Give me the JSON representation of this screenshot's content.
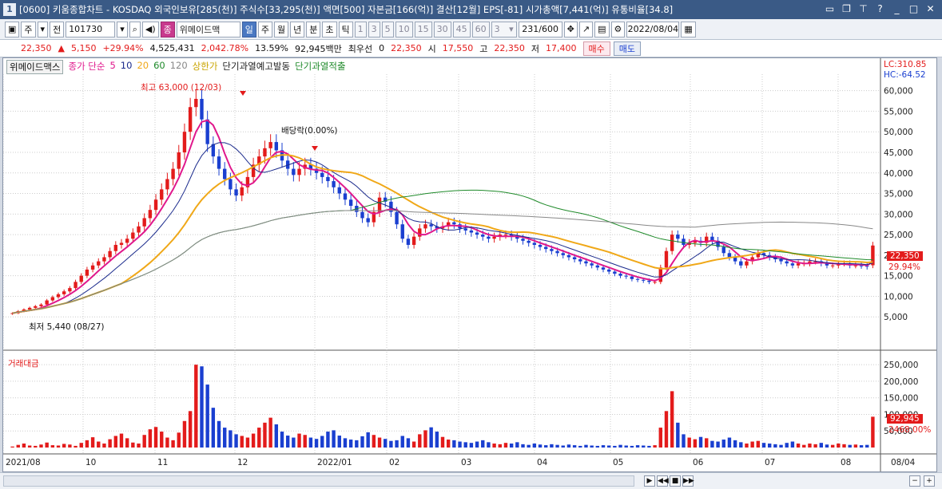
{
  "window": {
    "title": "[0600] 키움종합차트 - KOSDAQ 외국인보유[285(천)] 주식수[33,295(천)] 액면[500] 자본금[166(억)] 결산[12월] EPS[-81] 시가총액[7,441(억)] 유통비율[34.8]",
    "app_number": "1"
  },
  "toolbar": {
    "period_buttons": [
      "주",
      "전"
    ],
    "code": "101730",
    "stock_badge": "종",
    "stock_name": "위메이드맥",
    "intervals": [
      "일",
      "주",
      "월",
      "년",
      "분",
      "초",
      "틱"
    ],
    "minutes": [
      "1",
      "3",
      "5",
      "10",
      "15",
      "30",
      "45",
      "60"
    ],
    "count_select": "3",
    "count": "231",
    "count_total": "/600",
    "date": "2022/08/04"
  },
  "quote": {
    "price": "22,350",
    "change": "5,150",
    "change_pct": "+29.94%",
    "volume": "4,525,431",
    "vol_pct": "2,042.78%",
    "turnover": "13.59%",
    "amount": "92,945백만",
    "priority_label": "최우선",
    "priority_value": "0",
    "priority_price": "22,350",
    "open_label": "시",
    "open": "17,550",
    "high_label": "고",
    "high": "22,350",
    "low_label": "저",
    "low": "17,400",
    "buy": "매수",
    "sell": "매도"
  },
  "legend": {
    "name": "위메이드맥스",
    "ma_label": "종가 단순",
    "mas": [
      "5",
      "10",
      "20",
      "60",
      "120"
    ],
    "limit": "상한가",
    "sig1": "단기과열예고발동",
    "sig2": "단기과열적출"
  },
  "annotations": {
    "high": "최고 63,000 (12/03)",
    "dividend": "배당락(0.00%)",
    "low": "최저 5,440 (08/27)",
    "lc": "LC:310.85",
    "hc": "HC:-64.52",
    "cur_price": "22,350",
    "cur_pct": "29.94%",
    "vol_label": "거래대금",
    "cur_amount": "92,945",
    "cur_amount_pct": "2468.00%"
  },
  "price_axis": [
    "60,000",
    "55,000",
    "50,000",
    "45,000",
    "40,000",
    "35,000",
    "30,000",
    "25,000",
    "20,000",
    "15,000",
    "10,000",
    "5,000"
  ],
  "volume_axis": [
    "250,000",
    "200,000",
    "150,000",
    "100,000",
    "50,000"
  ],
  "date_axis": [
    "2021/08",
    "10",
    "11",
    "12",
    "2022/01",
    "02",
    "03",
    "04",
    "05",
    "06",
    "07",
    "08",
    "08/04"
  ],
  "colors": {
    "up": "#e31b1b",
    "down": "#1a3fd0",
    "ma5": "#e0188c",
    "ma10": "#1a2a8c",
    "ma20": "#f0a818",
    "ma60": "#1f8a2a",
    "ma120": "#888888"
  },
  "chart_data": {
    "type": "candlestick",
    "title": "위메이드맥스",
    "x_range": [
      "2021/08",
      "2022/08/04"
    ],
    "ylim": [
      0,
      63000
    ],
    "closes": [
      5900,
      6400,
      6800,
      7200,
      7600,
      8000,
      9000,
      9800,
      10500,
      11200,
      12000,
      13500,
      15000,
      16500,
      17500,
      18500,
      19500,
      21000,
      22500,
      23000,
      24000,
      25500,
      27000,
      29000,
      31000,
      33500,
      36000,
      38500,
      41000,
      45000,
      50000,
      56000,
      58000,
      53000,
      47000,
      44000,
      41000,
      38500,
      36000,
      34500,
      36500,
      39000,
      42000,
      44000,
      46000,
      47500,
      45500,
      43000,
      41000,
      39500,
      41000,
      42000,
      41000,
      40000,
      39000,
      38000,
      36500,
      35000,
      33500,
      32000,
      30500,
      29000,
      28000,
      30500,
      34000,
      33000,
      30500,
      27500,
      24000,
      22500,
      24500,
      26500,
      27500,
      27000,
      26500,
      27000,
      28000,
      27500,
      26500,
      26000,
      25500,
      25000,
      24500,
      24000,
      24500,
      25000,
      25000,
      24500,
      24000,
      23500,
      23000,
      22500,
      22000,
      21500,
      21000,
      20500,
      20000,
      19500,
      19000,
      18500,
      18000,
      17500,
      17000,
      16500,
      16000,
      15500,
      15000,
      14800,
      14200,
      14000,
      13800,
      13500,
      13500,
      17000,
      21000,
      25000,
      24000,
      22500,
      23000,
      23500,
      23000,
      24500,
      23500,
      22000,
      20500,
      19500,
      18500,
      17500,
      18500,
      19500,
      20500,
      20000,
      19500,
      19000,
      18500,
      18000,
      17500,
      18000,
      18000,
      18500,
      18500,
      18000,
      17500,
      17500,
      18000,
      18000,
      17500,
      17500,
      17400,
      17200,
      22350
    ],
    "volumes": [
      3000,
      8000,
      12000,
      6000,
      5000,
      9000,
      15000,
      7000,
      6000,
      11000,
      9000,
      5000,
      14000,
      22000,
      31000,
      18000,
      12000,
      25000,
      35000,
      42000,
      28000,
      15000,
      12000,
      38000,
      55000,
      62000,
      48000,
      30000,
      22000,
      45000,
      80000,
      110000,
      250000,
      245000,
      190000,
      120000,
      80000,
      60000,
      52000,
      40000,
      35000,
      30000,
      42000,
      60000,
      75000,
      90000,
      70000,
      48000,
      36000,
      30000,
      42000,
      38000,
      30000,
      26000,
      35000,
      48000,
      52000,
      36000,
      28000,
      24000,
      22000,
      34000,
      46000,
      38000,
      30000,
      26000,
      20000,
      22000,
      35000,
      28000,
      18000,
      40000,
      52000,
      61000,
      48000,
      32000,
      24000,
      22000,
      18000,
      16000,
      14000,
      18000,
      22000,
      16000,
      12000,
      10000,
      14000,
      12000,
      16000,
      10000,
      8000,
      12000,
      9000,
      7000,
      10000,
      8000,
      6000,
      9000,
      7000,
      5000,
      8000,
      6000,
      5000,
      7000,
      6000,
      5000,
      8000,
      6000,
      5000,
      7000,
      6000,
      5000,
      7000,
      60000,
      110000,
      170000,
      75000,
      40000,
      30000,
      25000,
      32000,
      28000,
      20000,
      18000,
      24000,
      30000,
      22000,
      16000,
      12000,
      18000,
      20000,
      14000,
      12000,
      10000,
      8000,
      14000,
      18000,
      12000,
      8000,
      12000,
      10000,
      14000,
      9000,
      8000,
      12000,
      10000,
      8000,
      9000,
      7000,
      8000,
      92945
    ]
  }
}
